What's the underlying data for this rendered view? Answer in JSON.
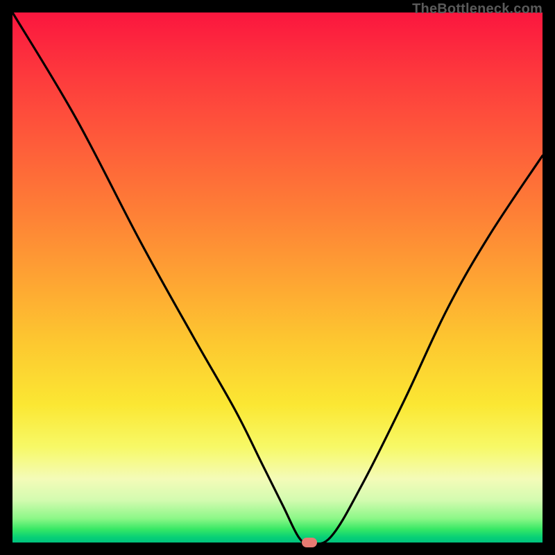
{
  "watermark": "TheBottleneck.com",
  "colors": {
    "curve": "#000000",
    "marker": "#e77a72",
    "background": "#000000"
  },
  "chart_data": {
    "type": "line",
    "title": "",
    "xlabel": "",
    "ylabel": "",
    "xlim": [
      0,
      100
    ],
    "ylim": [
      0,
      100
    ],
    "grid": false,
    "legend": false,
    "annotations": [
      {
        "kind": "marker",
        "shape": "pill",
        "x": 56,
        "y": 0,
        "fill": "#e77a72"
      }
    ],
    "series": [
      {
        "name": "bottleneck-curve",
        "color": "#000000",
        "x": [
          0,
          12,
          24,
          34,
          42,
          47,
          51,
          54,
          56,
          60,
          66,
          74,
          82,
          90,
          100
        ],
        "values": [
          100,
          80,
          57,
          39,
          25,
          15,
          7,
          1,
          0,
          1,
          11,
          27,
          44,
          58,
          73
        ]
      }
    ]
  }
}
